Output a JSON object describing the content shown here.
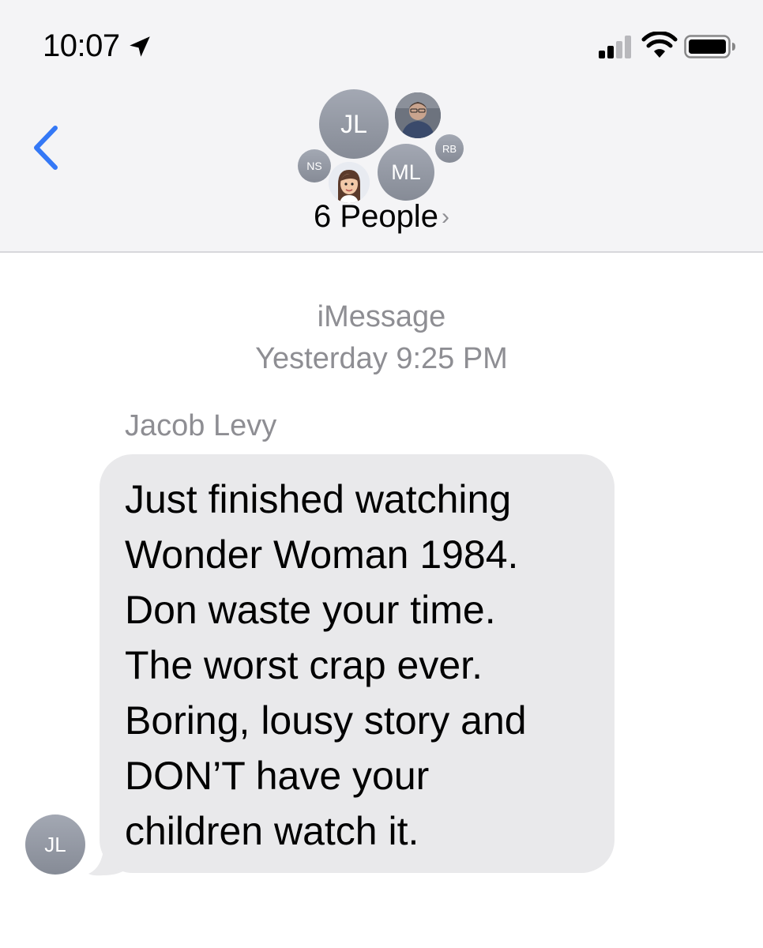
{
  "status_bar": {
    "time": "10:07",
    "location_icon": "location-arrow-icon",
    "signal_icon": "cellular-signal-icon",
    "wifi_icon": "wifi-icon",
    "battery_icon": "battery-icon"
  },
  "header": {
    "back_icon": "chevron-left-icon",
    "avatars": {
      "jl": "JL",
      "rb": "RB",
      "ns": "NS",
      "ml": "ML"
    },
    "people_label": "6 People",
    "people_chevron": "›"
  },
  "conversation": {
    "service": "iMessage",
    "timestamp": "Yesterday 9:25 PM",
    "sender_name": "Jacob Levy",
    "sender_initials": "JL",
    "message_text": "Just finished watching\nWonder Woman 1984.\nDon waste your time.\nThe worst crap ever.\nBoring, lousy story and\nDON’T have your\nchildren watch it."
  },
  "colors": {
    "accent": "#3478f6",
    "header_bg": "#f4f4f6",
    "bubble_bg": "#e9e9eb",
    "secondary_text": "#8e8e93",
    "avatar_gray": "#8f939d"
  }
}
